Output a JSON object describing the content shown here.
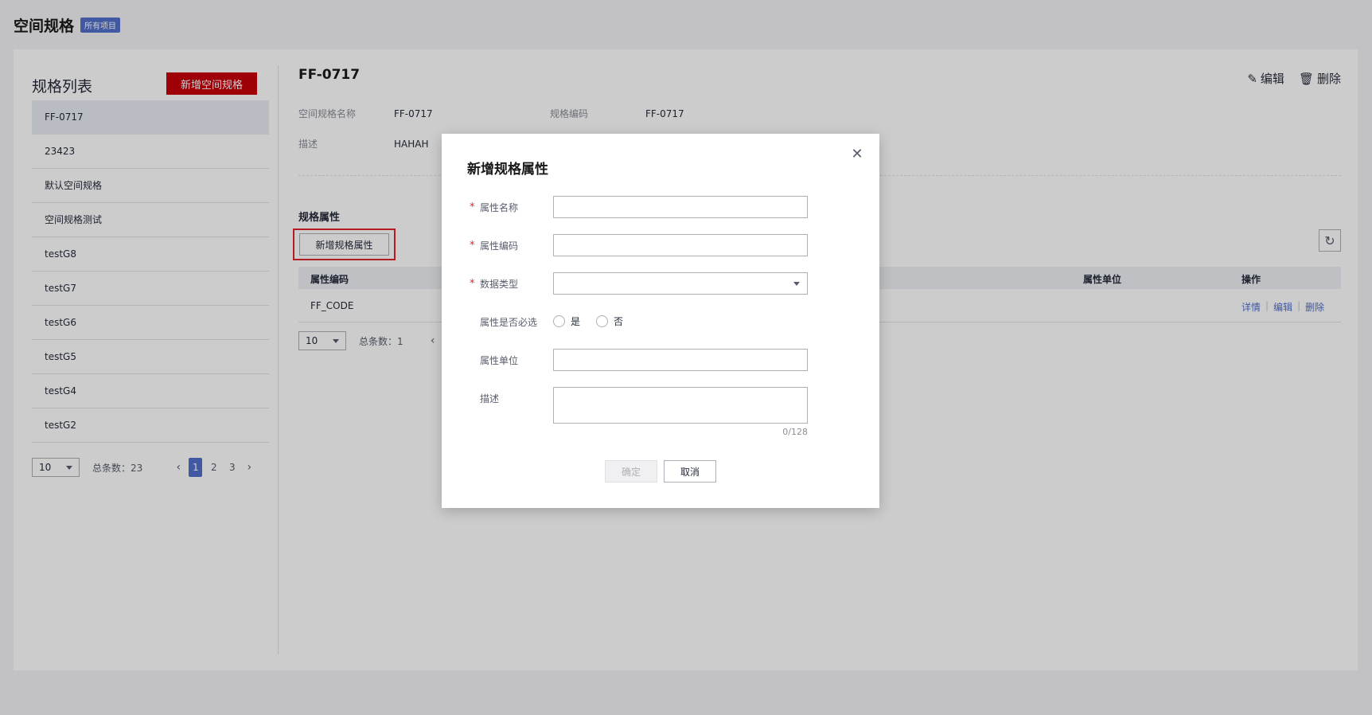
{
  "header": {
    "title": "空间规格",
    "project_tag": "所有项目"
  },
  "left": {
    "list_title": "规格列表",
    "add_button": "新增空间规格",
    "items": [
      {
        "label": "FF-0717",
        "active": true
      },
      {
        "label": "23423"
      },
      {
        "label": "默认空间规格"
      },
      {
        "label": "空间规格测试"
      },
      {
        "label": "testG8"
      },
      {
        "label": "testG7"
      },
      {
        "label": "testG6"
      },
      {
        "label": "testG5"
      },
      {
        "label": "testG4"
      },
      {
        "label": "testG2"
      }
    ],
    "pager": {
      "page_size": "10",
      "total": "总条数：23",
      "pages": [
        "1",
        "2",
        "3"
      ],
      "current": "1"
    }
  },
  "detail": {
    "title": "FF-0717",
    "edit_label": "编辑",
    "delete_label": "删除",
    "name_label": "空间规格名称",
    "name_value": "FF-0717",
    "code_label": "规格编码",
    "code_value": "FF-0717",
    "desc_label": "描述",
    "desc_value": "HAHAH",
    "section_title": "规格属性",
    "add_attr_button": "新增规格属性",
    "table": {
      "columns": [
        "属性编码",
        "属性单位",
        "操作"
      ],
      "rows": [
        {
          "code": "FF_CODE",
          "unit": "",
          "ops": [
            "详情",
            "编辑",
            "删除"
          ]
        }
      ]
    },
    "pager": {
      "page_size": "10",
      "total": "总条数：1"
    }
  },
  "modal": {
    "title": "新增规格属性",
    "fields": {
      "name_label": "属性名称",
      "code_label": "属性编码",
      "type_label": "数据类型",
      "required_label": "属性是否必选",
      "required_yes": "是",
      "required_no": "否",
      "unit_label": "属性单位",
      "desc_label": "描述",
      "desc_counter": "0/128"
    },
    "ok_label": "确定",
    "cancel_label": "取消"
  },
  "colors": {
    "brand_red": "#c7000b",
    "primary_blue": "#526ecc",
    "highlight_border": "#e0242c"
  }
}
